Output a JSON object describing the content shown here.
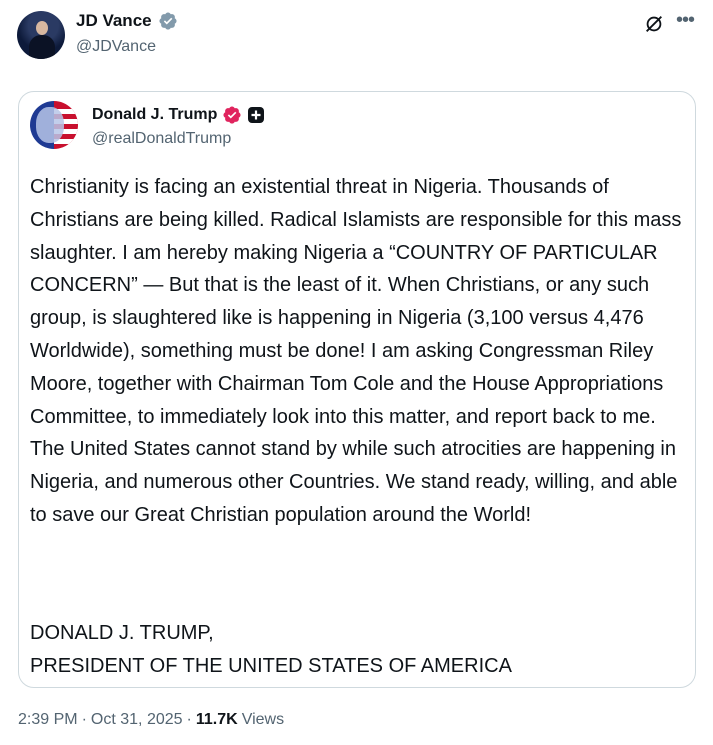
{
  "tweet": {
    "author": {
      "name": "JD Vance",
      "handle": "@JDVance",
      "verified_color": "#829aab"
    },
    "quoted": {
      "name": "Donald J. Trump",
      "handle": "@realDonaldTrump",
      "verified_color": "#e0245e",
      "body": "Christianity is facing an existential threat in Nigeria. Thousands of Christians are being killed. Radical Islamists are responsible for this mass slaughter. I am hereby making Nigeria a “COUNTRY OF PARTICULAR CONCERN” — But that is the least of it. When Christians, or any such group, is slaughtered like is happening in Nigeria (3,100 versus 4,476 Worldwide), something must be done! I am asking Congressman Riley Moore, together with Chairman Tom Cole and the House Appropriations Committee, to immediately look into this matter, and report back to me. The United States cannot stand by while such atrocities are happening in Nigeria, and numerous other Countries. We stand ready, willing, and able to save our Great Christian population around the World!",
      "signature_line1": "DONALD J. TRUMP,",
      "signature_line2": "PRESIDENT OF THE UNITED STATES OF AMERICA"
    },
    "meta": {
      "time": "2:39 PM",
      "separator": "·",
      "date": "Oct 31, 2025",
      "views_count": "11.7K",
      "views_label": "Views"
    }
  },
  "icons": {
    "grok": "grok-icon",
    "more": "more-icon",
    "verified": "verified-badge-icon",
    "affiliate": "affiliate-badge-icon"
  }
}
